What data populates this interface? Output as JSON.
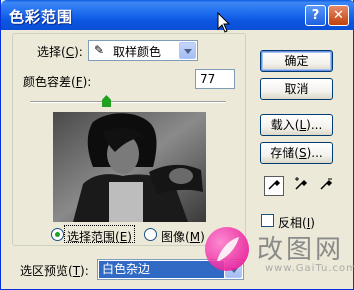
{
  "window": {
    "title": "色彩范围",
    "help_glyph": "?",
    "close_glyph": "✕"
  },
  "select": {
    "label": "选择",
    "hotkey": "C",
    "value": "取样颜色",
    "icon": "eyedropper-icon"
  },
  "fuzziness": {
    "label": "颜色容差",
    "hotkey": "F",
    "value": "77",
    "level": 0.39
  },
  "radios": {
    "selection": {
      "label": "选择范围",
      "hotkey": "E",
      "checked": true
    },
    "image": {
      "label": "图像",
      "hotkey": "M",
      "checked": false
    }
  },
  "buttons": {
    "ok": "确定",
    "cancel": "取消",
    "load": "载入",
    "load_hotkey": "L",
    "save": "存储",
    "save_hotkey": "S",
    "ellipsis": "..."
  },
  "eyedroppers": [
    "eyedropper-icon",
    "eyedropper-plus-icon",
    "eyedropper-minus-icon"
  ],
  "invert": {
    "label": "反相",
    "hotkey": "I",
    "checked": false
  },
  "selection_preview": {
    "label": "选区预览",
    "hotkey": "T",
    "value": "白色杂边"
  },
  "watermark": {
    "text": "改图网",
    "sub": "www.GaiTu.com"
  },
  "colors": {
    "titlebar": "#0a5de3",
    "face": "#ece9d8",
    "accent": "#316ac5",
    "slider_thumb": "#21a121"
  }
}
